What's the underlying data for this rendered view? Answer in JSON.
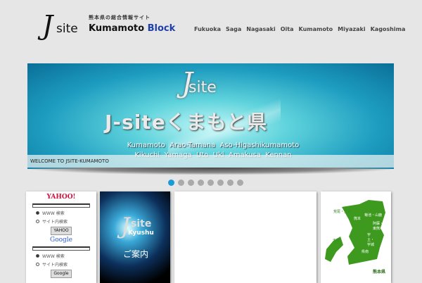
{
  "header": {
    "logo_j": "J",
    "logo_site": "site",
    "tagline": "熊本県の総合情報サイト",
    "brand_main": "Kumamoto",
    "brand_accent": "Block"
  },
  "nav": [
    "Fukuoka",
    "Saga",
    "Nagasaki",
    "Oita",
    "Kumamoto",
    "Miyazaki",
    "Kagoshima"
  ],
  "banner": {
    "logo_j": "J",
    "logo_site": "site",
    "title": "J-siteくまもと県",
    "line1": "Kumamoto  Arao-Tamana  Aso-Higashikumamoto",
    "line2": "Kikuchi  Yamaga  Uto  Uki  Amakusa  Kennan",
    "caption": "WELCOME TO JSITE-KUMAMOTO",
    "slide_count": 8,
    "active_slide": 1
  },
  "search": {
    "yahoo_logo": "YAHOO!",
    "yahoo_radio1": "WWW 検索",
    "yahoo_radio2": "サイト内検索",
    "yahoo_button": "YAHOO",
    "google_logo": "Google",
    "google_radio1": "WWW 検索",
    "google_radio2": "サイト内検索",
    "google_button": "Google"
  },
  "kyushu": {
    "logo_j": "J",
    "logo_site": "site",
    "name": "Kyushu",
    "guide": "ご案内"
  },
  "map": {
    "labels": [
      "荒尾・玉名",
      "菊池・山鹿",
      "熊本",
      "阿蘇・東熊本",
      "宇土・宇城",
      "天草",
      "県南"
    ],
    "title": "熊本県"
  }
}
